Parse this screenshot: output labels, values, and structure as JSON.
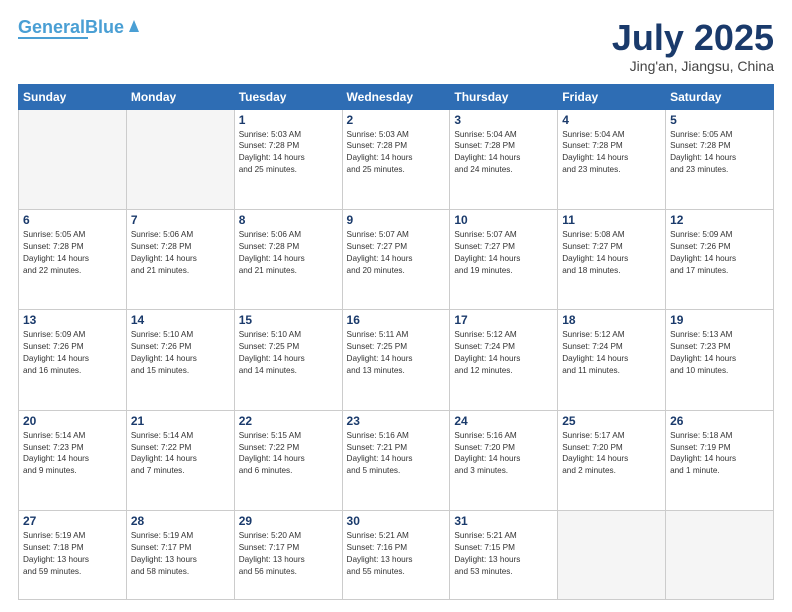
{
  "header": {
    "logo_line1": "General",
    "logo_line2": "Blue",
    "month_year": "July 2025",
    "location": "Jing'an, Jiangsu, China"
  },
  "weekdays": [
    "Sunday",
    "Monday",
    "Tuesday",
    "Wednesday",
    "Thursday",
    "Friday",
    "Saturday"
  ],
  "weeks": [
    [
      {
        "day": "",
        "info": ""
      },
      {
        "day": "",
        "info": ""
      },
      {
        "day": "1",
        "info": "Sunrise: 5:03 AM\nSunset: 7:28 PM\nDaylight: 14 hours\nand 25 minutes."
      },
      {
        "day": "2",
        "info": "Sunrise: 5:03 AM\nSunset: 7:28 PM\nDaylight: 14 hours\nand 25 minutes."
      },
      {
        "day": "3",
        "info": "Sunrise: 5:04 AM\nSunset: 7:28 PM\nDaylight: 14 hours\nand 24 minutes."
      },
      {
        "day": "4",
        "info": "Sunrise: 5:04 AM\nSunset: 7:28 PM\nDaylight: 14 hours\nand 23 minutes."
      },
      {
        "day": "5",
        "info": "Sunrise: 5:05 AM\nSunset: 7:28 PM\nDaylight: 14 hours\nand 23 minutes."
      }
    ],
    [
      {
        "day": "6",
        "info": "Sunrise: 5:05 AM\nSunset: 7:28 PM\nDaylight: 14 hours\nand 22 minutes."
      },
      {
        "day": "7",
        "info": "Sunrise: 5:06 AM\nSunset: 7:28 PM\nDaylight: 14 hours\nand 21 minutes."
      },
      {
        "day": "8",
        "info": "Sunrise: 5:06 AM\nSunset: 7:28 PM\nDaylight: 14 hours\nand 21 minutes."
      },
      {
        "day": "9",
        "info": "Sunrise: 5:07 AM\nSunset: 7:27 PM\nDaylight: 14 hours\nand 20 minutes."
      },
      {
        "day": "10",
        "info": "Sunrise: 5:07 AM\nSunset: 7:27 PM\nDaylight: 14 hours\nand 19 minutes."
      },
      {
        "day": "11",
        "info": "Sunrise: 5:08 AM\nSunset: 7:27 PM\nDaylight: 14 hours\nand 18 minutes."
      },
      {
        "day": "12",
        "info": "Sunrise: 5:09 AM\nSunset: 7:26 PM\nDaylight: 14 hours\nand 17 minutes."
      }
    ],
    [
      {
        "day": "13",
        "info": "Sunrise: 5:09 AM\nSunset: 7:26 PM\nDaylight: 14 hours\nand 16 minutes."
      },
      {
        "day": "14",
        "info": "Sunrise: 5:10 AM\nSunset: 7:26 PM\nDaylight: 14 hours\nand 15 minutes."
      },
      {
        "day": "15",
        "info": "Sunrise: 5:10 AM\nSunset: 7:25 PM\nDaylight: 14 hours\nand 14 minutes."
      },
      {
        "day": "16",
        "info": "Sunrise: 5:11 AM\nSunset: 7:25 PM\nDaylight: 14 hours\nand 13 minutes."
      },
      {
        "day": "17",
        "info": "Sunrise: 5:12 AM\nSunset: 7:24 PM\nDaylight: 14 hours\nand 12 minutes."
      },
      {
        "day": "18",
        "info": "Sunrise: 5:12 AM\nSunset: 7:24 PM\nDaylight: 14 hours\nand 11 minutes."
      },
      {
        "day": "19",
        "info": "Sunrise: 5:13 AM\nSunset: 7:23 PM\nDaylight: 14 hours\nand 10 minutes."
      }
    ],
    [
      {
        "day": "20",
        "info": "Sunrise: 5:14 AM\nSunset: 7:23 PM\nDaylight: 14 hours\nand 9 minutes."
      },
      {
        "day": "21",
        "info": "Sunrise: 5:14 AM\nSunset: 7:22 PM\nDaylight: 14 hours\nand 7 minutes."
      },
      {
        "day": "22",
        "info": "Sunrise: 5:15 AM\nSunset: 7:22 PM\nDaylight: 14 hours\nand 6 minutes."
      },
      {
        "day": "23",
        "info": "Sunrise: 5:16 AM\nSunset: 7:21 PM\nDaylight: 14 hours\nand 5 minutes."
      },
      {
        "day": "24",
        "info": "Sunrise: 5:16 AM\nSunset: 7:20 PM\nDaylight: 14 hours\nand 3 minutes."
      },
      {
        "day": "25",
        "info": "Sunrise: 5:17 AM\nSunset: 7:20 PM\nDaylight: 14 hours\nand 2 minutes."
      },
      {
        "day": "26",
        "info": "Sunrise: 5:18 AM\nSunset: 7:19 PM\nDaylight: 14 hours\nand 1 minute."
      }
    ],
    [
      {
        "day": "27",
        "info": "Sunrise: 5:19 AM\nSunset: 7:18 PM\nDaylight: 13 hours\nand 59 minutes."
      },
      {
        "day": "28",
        "info": "Sunrise: 5:19 AM\nSunset: 7:17 PM\nDaylight: 13 hours\nand 58 minutes."
      },
      {
        "day": "29",
        "info": "Sunrise: 5:20 AM\nSunset: 7:17 PM\nDaylight: 13 hours\nand 56 minutes."
      },
      {
        "day": "30",
        "info": "Sunrise: 5:21 AM\nSunset: 7:16 PM\nDaylight: 13 hours\nand 55 minutes."
      },
      {
        "day": "31",
        "info": "Sunrise: 5:21 AM\nSunset: 7:15 PM\nDaylight: 13 hours\nand 53 minutes."
      },
      {
        "day": "",
        "info": ""
      },
      {
        "day": "",
        "info": ""
      }
    ]
  ]
}
